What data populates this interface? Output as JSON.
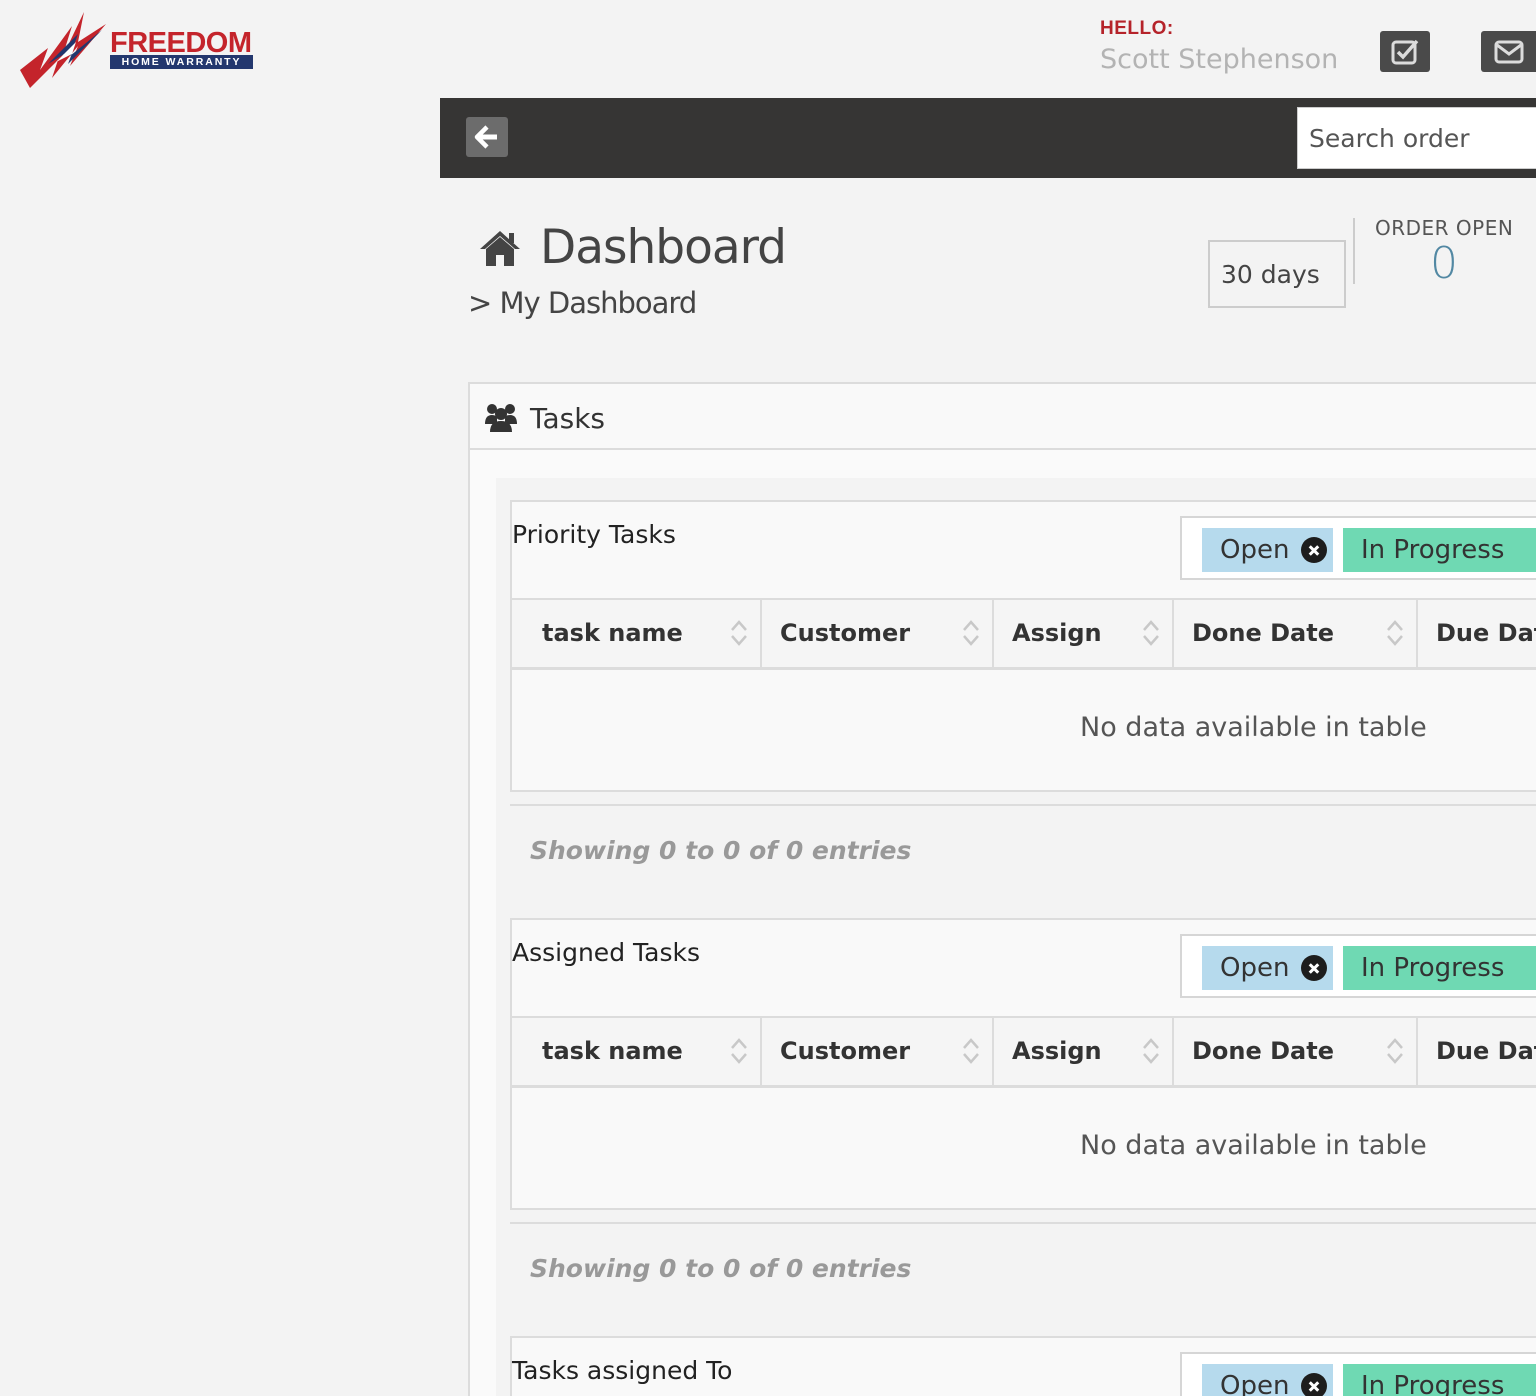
{
  "brand": {
    "name": "FREEDOM",
    "tagline": "HOME WARRANTY",
    "colors": {
      "red": "#c4242b",
      "navy": "#23376e"
    }
  },
  "header": {
    "greeting": "HELLO:",
    "user_name": "Scott Stephenson",
    "buttons": [
      {
        "icon": "check-square-icon"
      },
      {
        "icon": "envelope-icon"
      }
    ]
  },
  "topbar": {
    "back_icon": "arrow-left-icon",
    "search": {
      "placeholder": "Search order",
      "value": ""
    }
  },
  "page": {
    "title": "Dashboard",
    "title_icon": "home-icon",
    "breadcrumb": "> My Dashboard",
    "period_select": {
      "value": "30 days"
    },
    "order_open": {
      "label": "ORDER OPEN",
      "value": "0"
    }
  },
  "panel": {
    "title": "Tasks",
    "icon": "users-icon",
    "columns": [
      "task  name",
      "Customer",
      "Assign",
      "Done Date",
      "Due Date"
    ],
    "sections": [
      {
        "title": "Priority Tasks",
        "filters": [
          "Open",
          "In Progress"
        ],
        "empty_message": "No data available in table",
        "info": "Showing 0 to 0 of 0 entries"
      },
      {
        "title": "Assigned Tasks",
        "filters": [
          "Open",
          "In Progress"
        ],
        "empty_message": "No data available in table",
        "info": "Showing 0 to 0 of 0 entries"
      },
      {
        "title": "Tasks assigned To",
        "filters": [
          "Open",
          "In Progress"
        ]
      }
    ]
  },
  "colors": {
    "chip_open": "#b6daed",
    "chip_in_progress": "#6fd9b3",
    "topbar": "#363534",
    "order_open_value": "#5288a3"
  }
}
